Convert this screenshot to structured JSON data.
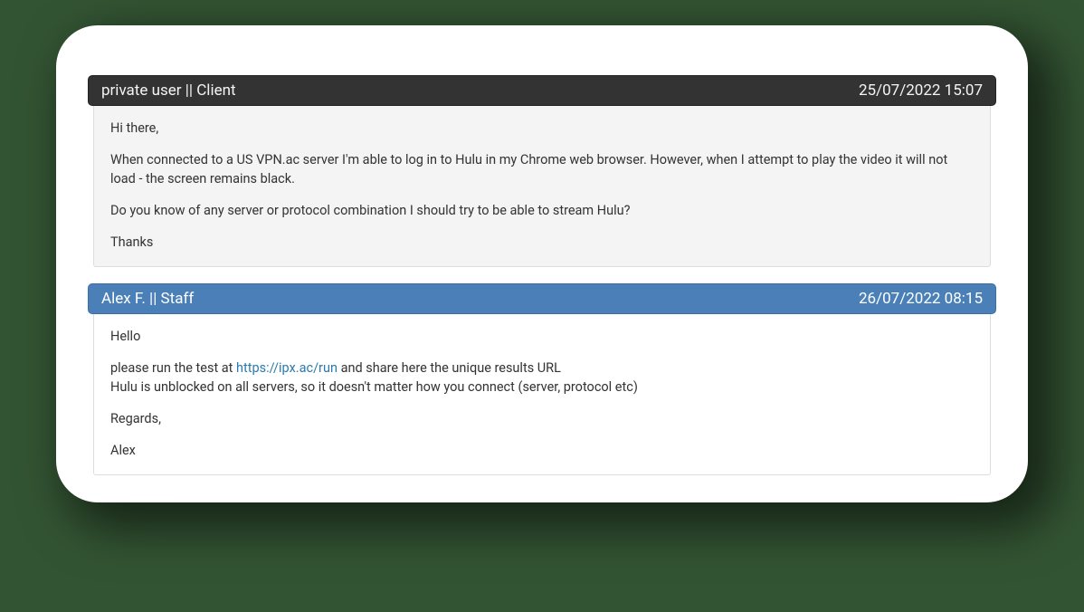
{
  "thread": [
    {
      "author": "private user || Client",
      "role": "client",
      "timestamp": "25/07/2022 15:07",
      "body": {
        "p1": "Hi there,",
        "p2": "When connected to a US VPN.ac server I'm able to log in to Hulu in my Chrome web browser. However, when I attempt to play the video it will not load - the screen remains black.",
        "p3": "Do you know of any server or protocol combination I should try to be able to stream Hulu?",
        "p4": "Thanks"
      }
    },
    {
      "author": "Alex F. || Staff",
      "role": "staff",
      "timestamp": "26/07/2022 08:15",
      "body": {
        "p1": "Hello",
        "p2a": "please run the test at ",
        "p2link": "https://ipx.ac/run",
        "p2b": " and share here the unique results URL",
        "p3": "Hulu is unblocked on all servers, so it doesn't matter how you connect (server, protocol etc)",
        "p4": "Regards,",
        "p5": "Alex"
      }
    }
  ]
}
